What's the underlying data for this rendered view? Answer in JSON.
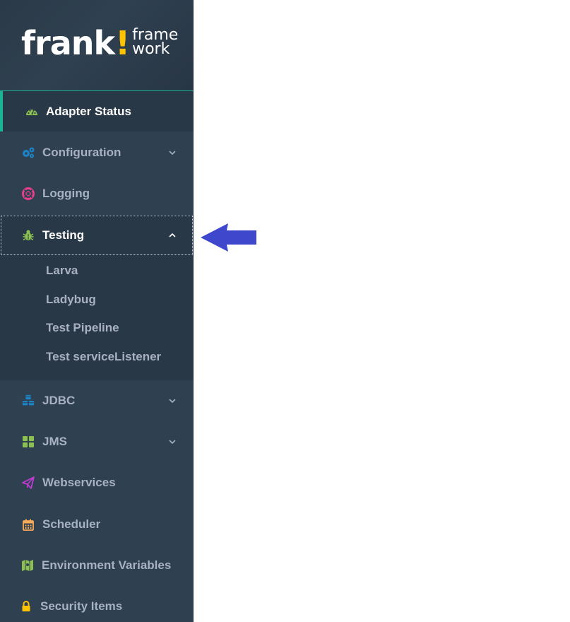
{
  "logo": {
    "main": "frank",
    "bang": "!",
    "sub_top": "frame",
    "sub_bottom": "work"
  },
  "sidebar": {
    "items": [
      {
        "label": "Adapter Status",
        "icon": "dashboard-icon",
        "active": true
      },
      {
        "label": "Configuration",
        "icon": "cogs-icon",
        "has_submenu": true
      },
      {
        "label": "Logging",
        "icon": "life-ring-icon"
      },
      {
        "label": "Testing",
        "icon": "bug-icon",
        "expanded": true
      },
      {
        "label": "JDBC",
        "icon": "cubes-icon",
        "has_submenu": true
      },
      {
        "label": "JMS",
        "icon": "th-large-icon",
        "has_submenu": true
      },
      {
        "label": "Webservices",
        "icon": "paper-plane-icon"
      },
      {
        "label": "Scheduler",
        "icon": "calendar-icon"
      },
      {
        "label": "Environment Variables",
        "icon": "map-icon"
      },
      {
        "label": "Security Items",
        "icon": "lock-icon"
      }
    ],
    "testing_submenu": [
      "Larva",
      "Ladybug",
      "Test Pipeline",
      "Test serviceListener"
    ]
  },
  "colors": {
    "sidebar_bg": "#2f4050",
    "active_bg": "#293846",
    "accent": "#1ab394",
    "logo_accent": "#fdc300",
    "annotation_arrow": "#3f48cc"
  }
}
